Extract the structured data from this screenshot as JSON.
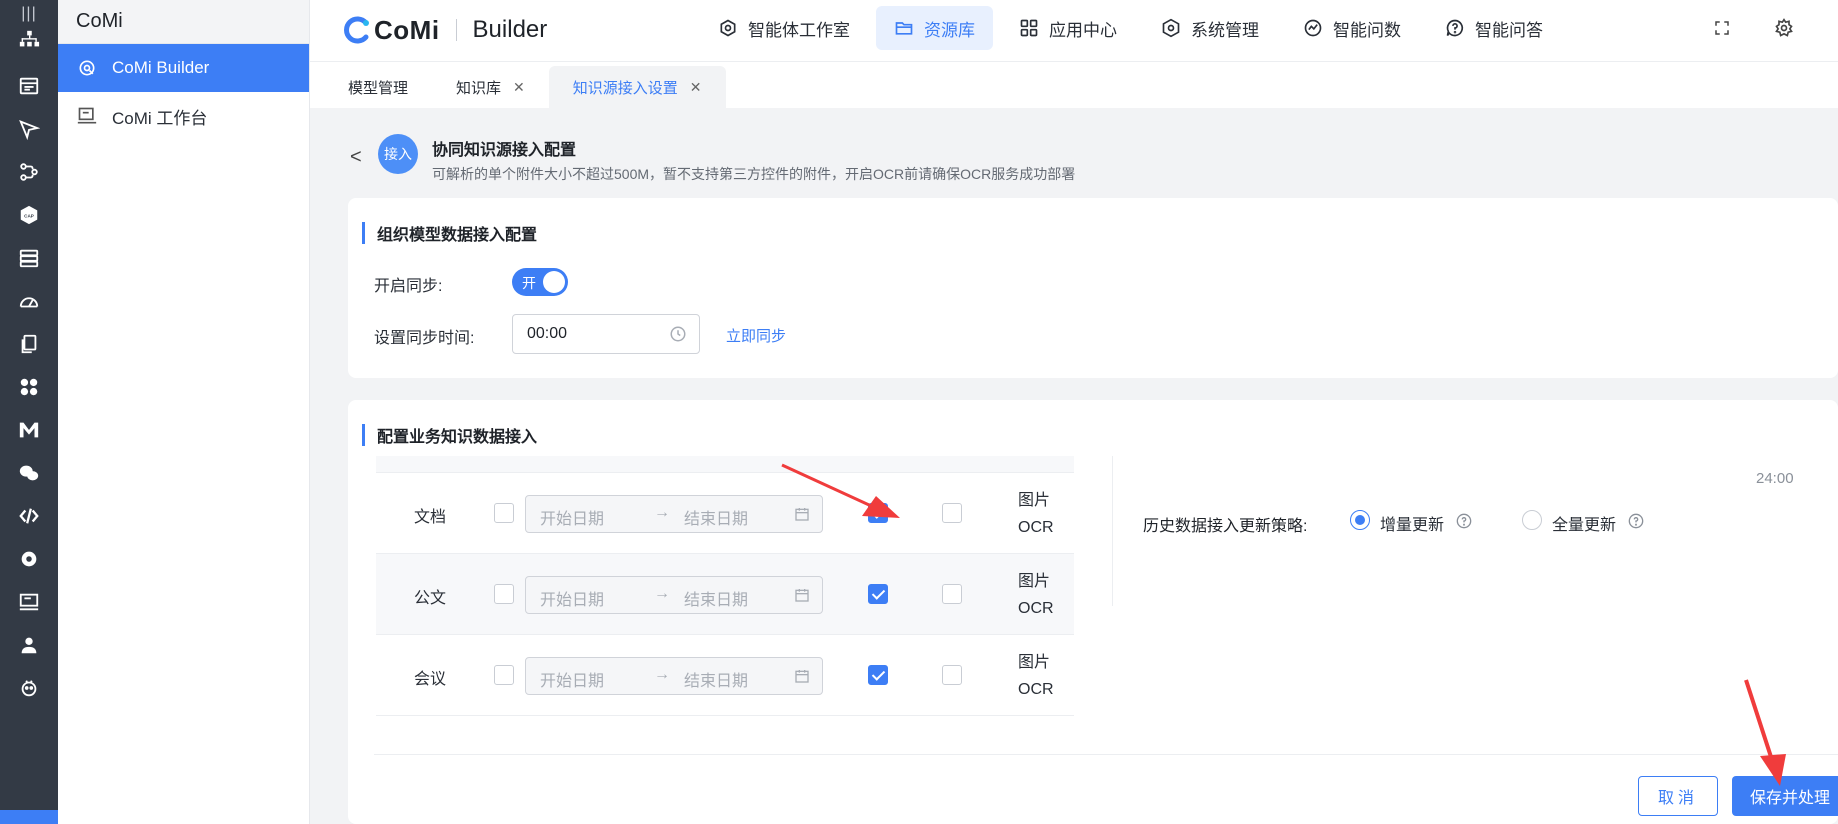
{
  "app": {
    "rail_top": "|||",
    "sidebar_title": "CoMi",
    "sidebar_items": [
      {
        "label": "CoMi Builder",
        "icon": "builder-icon",
        "active": true
      },
      {
        "label": "CoMi 工作台",
        "icon": "workbench-icon",
        "active": false
      }
    ]
  },
  "header": {
    "logo_text": "CoMi",
    "logo_sub": "Builder",
    "nav": [
      {
        "label": "智能体工作室",
        "icon": "agent-studio-icon",
        "active": false
      },
      {
        "label": "资源库",
        "icon": "folder-icon",
        "active": true
      },
      {
        "label": "应用中心",
        "icon": "grid-icon",
        "active": false
      },
      {
        "label": "系统管理",
        "icon": "hexagon-settings-icon",
        "active": false
      },
      {
        "label": "智能问数",
        "icon": "chart-icon",
        "active": false
      },
      {
        "label": "智能问答",
        "icon": "qa-icon",
        "active": false
      }
    ]
  },
  "tabs": [
    {
      "label": "模型管理",
      "closable": false,
      "active": false
    },
    {
      "label": "知识库",
      "closable": true,
      "active": false
    },
    {
      "label": "知识源接入设置",
      "closable": true,
      "active": true
    }
  ],
  "page": {
    "back": "<",
    "avatar": "接入",
    "title": "协同知识源接入配置",
    "subtitle": "可解析的单个附件大小不超过500M，暂不支持第三方控件的附件，开启OCR前请确保OCR服务成功部署"
  },
  "org_section": {
    "title": "组织模型数据接入配置",
    "sync_label": "开启同步:",
    "sync_toggle": "开",
    "time_label": "设置同步时间:",
    "time_value": "00:00",
    "sync_now": "立即同步"
  },
  "biz_section": {
    "title": "配置业务知识数据接入",
    "rows": [
      {
        "label": "文档",
        "start": "开始日期",
        "end": "结束日期",
        "arrow": "→",
        "ocr": "图片OCR",
        "checked": true
      },
      {
        "label": "公文",
        "start": "开始日期",
        "end": "结束日期",
        "arrow": "→",
        "ocr": "图片OCR",
        "checked": true
      },
      {
        "label": "会议",
        "start": "开始日期",
        "end": "结束日期",
        "arrow": "→",
        "ocr": "图片OCR",
        "checked": true
      }
    ],
    "time_24": "24:00",
    "strategy_label": "历史数据接入更新策略:",
    "strategy_options": [
      {
        "label": "增量更新",
        "selected": true
      },
      {
        "label": "全量更新",
        "selected": false
      }
    ],
    "cancel": "取消",
    "save": "保存并处理"
  },
  "colors": {
    "primary": "#3d7ef5",
    "rail": "#333a45",
    "annotation_arrow": "#f03c3c"
  }
}
